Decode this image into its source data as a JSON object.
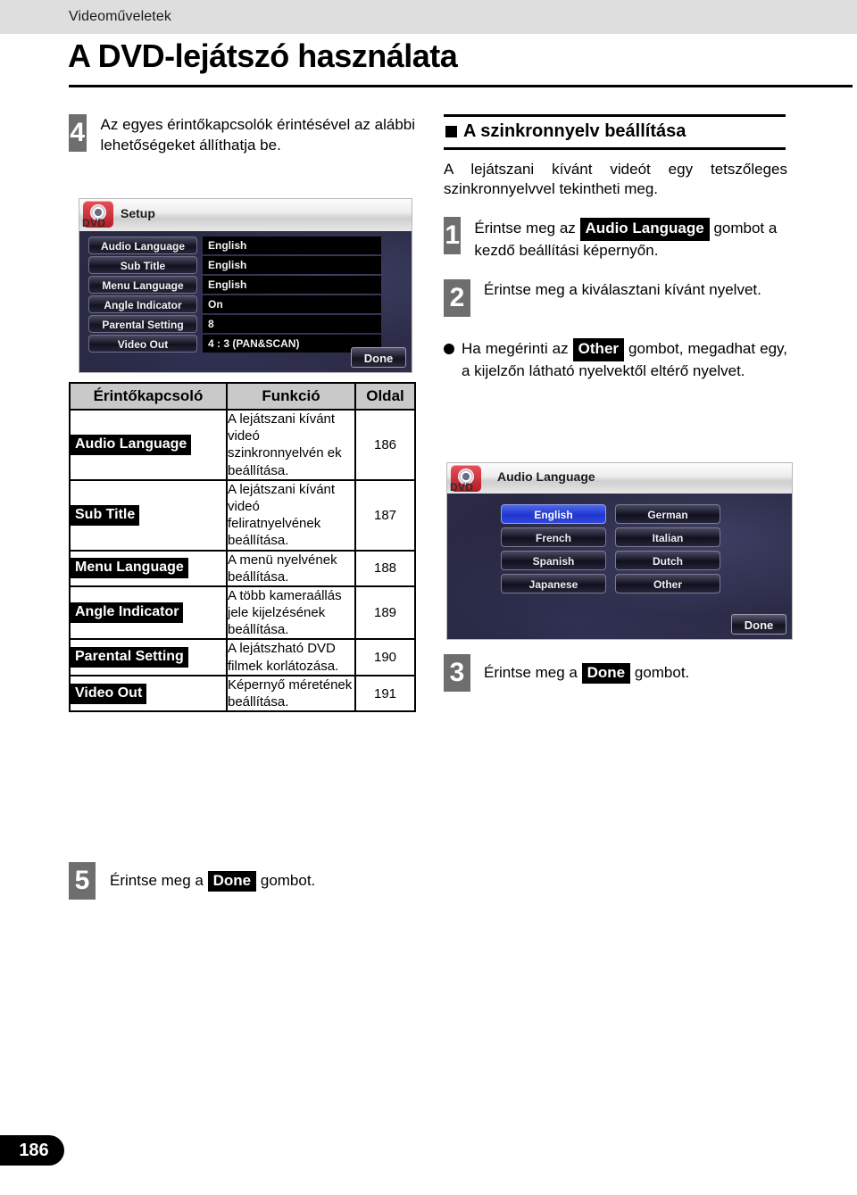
{
  "header": {
    "section_label": "Videoműveletek",
    "title": "A DVD-lejátszó használata"
  },
  "left": {
    "step4": {
      "number": "4",
      "text": "Az egyes érintőkapcsolók érintésével az alábbi lehetőségeket állíthatja be."
    },
    "setup_screen": {
      "device_label": "DVD",
      "title": "Setup",
      "rows": [
        {
          "key": "Audio Language",
          "value": "English"
        },
        {
          "key": "Sub Title",
          "value": "English"
        },
        {
          "key": "Menu Language",
          "value": "English"
        },
        {
          "key": "Angle Indicator",
          "value": "On"
        },
        {
          "key": "Parental Setting",
          "value": "8"
        },
        {
          "key": "Video Out",
          "value": "4 : 3 (PAN&SCAN)"
        }
      ],
      "done_label": "Done"
    },
    "table": {
      "headers": [
        "Érintőkapcsoló",
        "Funkció",
        "Oldal"
      ],
      "rows": [
        {
          "key": "Audio Language",
          "func": "A lejátszani kívánt videó szinkronnyelvén ek beállítása.",
          "page": "186"
        },
        {
          "key": "Sub Title",
          "func": "A lejátszani kívánt videó feliratnyelvének beállítása.",
          "page": "187"
        },
        {
          "key": "Menu Language",
          "func": "A menü nyelvének beállítása.",
          "page": "188"
        },
        {
          "key": "Angle Indicator",
          "func": "A több kameraállás jele kijelzésének beállítása.",
          "page": "189"
        },
        {
          "key": "Parental Setting",
          "func": "A lejátszható DVD filmek korlátozása.",
          "page": "190"
        },
        {
          "key": "Video Out",
          "func": "Képernyő méretének beállítása.",
          "page": "191"
        }
      ]
    },
    "step5": {
      "number": "5",
      "text_before": "Érintse meg a",
      "button": "Done",
      "text_after": "gombot."
    }
  },
  "right": {
    "heading": "A szinkronnyelv beállítása",
    "intro": "A lejátszani kívánt videót egy tetszőleges szinkronnyelvvel tekintheti meg.",
    "step1": {
      "number": "1",
      "text_before": "Érintse meg az",
      "button": "Audio Language",
      "text_after": "gombot a kezdő beállítási képernyőn."
    },
    "step2": {
      "number": "2",
      "text": "Érintse meg a kiválasztani kívánt nyelvet."
    },
    "note": {
      "text_before": "Ha megérinti az",
      "button": "Other",
      "text_after": "gombot, megadhat egy, a kijelzőn látható nyelvektől eltérő nyelvet."
    },
    "audio_screen": {
      "device_label": "DVD",
      "title": "Audio Language",
      "languages": [
        "English",
        "German",
        "French",
        "Italian",
        "Spanish",
        "Dutch",
        "Japanese",
        "Other"
      ],
      "selected": "English",
      "done_label": "Done"
    },
    "step3": {
      "number": "3",
      "text_before": "Érintse meg a",
      "button": "Done",
      "text_after": "gombot."
    }
  },
  "footer": {
    "page_number": "186"
  },
  "colors": {
    "header_band": "#dedede",
    "step_badge": "#6e6e6e",
    "table_header": "#c9c9c9",
    "screen_bg": "#26263c",
    "selected_button": "#2036cf",
    "dvd_icon": "#b21c26"
  }
}
